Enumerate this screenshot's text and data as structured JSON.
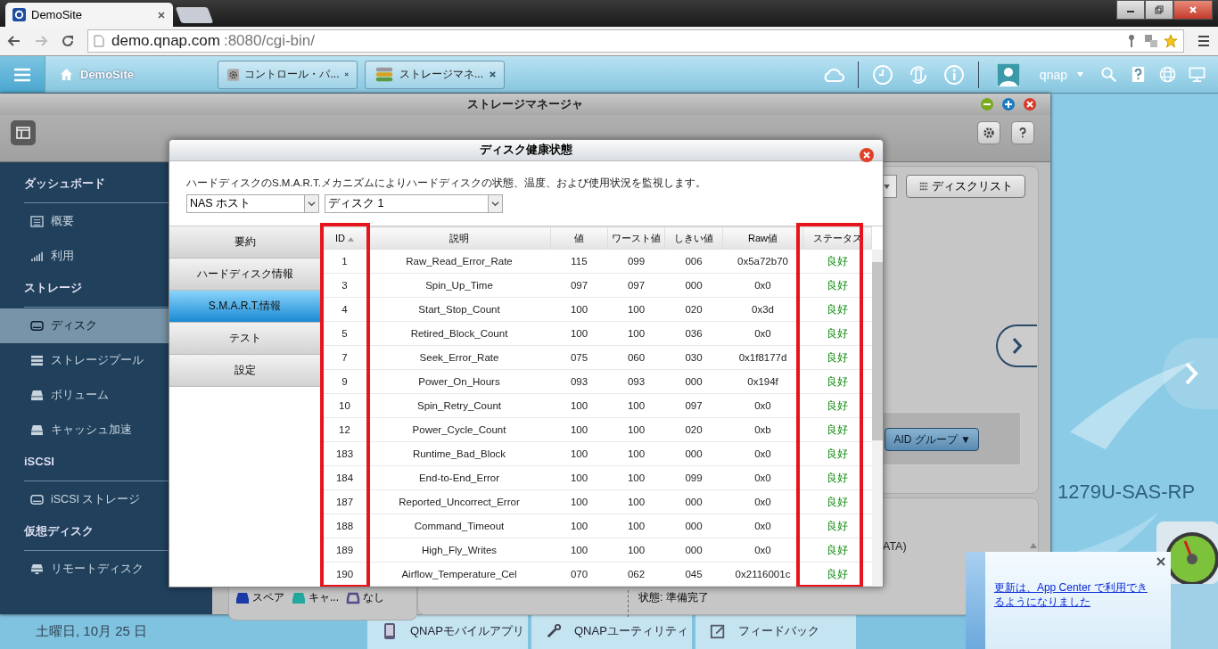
{
  "browser": {
    "tab_title": "DemoSite",
    "url_host": "demo.qnap.com",
    "url_rest": ":8080/cgi-bin/"
  },
  "topbar": {
    "home_label": "DemoSite",
    "app_tabs": [
      {
        "label": "コントロール・パ..."
      },
      {
        "label": "ストレージマネ..."
      }
    ],
    "user": "qnap"
  },
  "window": {
    "title": "ストレージマネージャ",
    "sidebar": [
      {
        "heading": "ダッシュボード",
        "items": [
          {
            "label": "概要",
            "selected": false
          },
          {
            "label": "利用",
            "selected": false
          }
        ]
      },
      {
        "heading": "ストレージ",
        "items": [
          {
            "label": "ディスク",
            "selected": true
          },
          {
            "label": "ストレージプール",
            "selected": false
          },
          {
            "label": "ボリューム",
            "selected": false
          },
          {
            "label": "キャッシュ加速",
            "selected": false
          }
        ]
      },
      {
        "heading": "iSCSI",
        "items": [
          {
            "label": "iSCSI ストレージ",
            "selected": false
          }
        ]
      },
      {
        "heading": "仮想ディスク",
        "items": [
          {
            "label": "リモートディスク",
            "selected": false
          }
        ]
      }
    ],
    "disk_list_button": "ディスクリスト",
    "raid_button": "AID グループ ▼",
    "info_fragment": "ATA)",
    "status_text": "状態: 準備完了",
    "legend": [
      {
        "label": "スペア",
        "color": "#1b3aa8",
        "kind": "filled"
      },
      {
        "label": "キャ...",
        "color": "#22a89c",
        "kind": "filled"
      },
      {
        "label": "なし",
        "color": "#5a4a8a",
        "kind": "outline"
      }
    ]
  },
  "dialog": {
    "title": "ディスク健康状態",
    "description": "ハードディスクのS.M.A.R.T.メカニズムによりハードディスクの状態、温度、および使用状況を監視します。",
    "host_select": "NAS ホスト",
    "disk_select": "ディスク 1",
    "menu": [
      {
        "label": "要約",
        "selected": false
      },
      {
        "label": "ハードディスク情報",
        "selected": false
      },
      {
        "label": "S.M.A.R.T.情報",
        "selected": true
      },
      {
        "label": "テスト",
        "selected": false
      },
      {
        "label": "設定",
        "selected": false
      }
    ],
    "table": {
      "columns": [
        {
          "label": "ID",
          "highlighted": true,
          "sorted": true
        },
        {
          "label": "説明",
          "highlighted": false,
          "sorted": false
        },
        {
          "label": "値",
          "highlighted": false,
          "sorted": false
        },
        {
          "label": "ワースト値",
          "highlighted": false,
          "sorted": false
        },
        {
          "label": "しきい値",
          "highlighted": false,
          "sorted": false
        },
        {
          "label": "Raw値",
          "highlighted": false,
          "sorted": false
        },
        {
          "label": "ステータス",
          "highlighted": true,
          "sorted": false
        }
      ],
      "rows": [
        [
          "1",
          "Raw_Read_Error_Rate",
          "115",
          "099",
          "006",
          "0x5a72b70",
          "良好"
        ],
        [
          "3",
          "Spin_Up_Time",
          "097",
          "097",
          "000",
          "0x0",
          "良好"
        ],
        [
          "4",
          "Start_Stop_Count",
          "100",
          "100",
          "020",
          "0x3d",
          "良好"
        ],
        [
          "5",
          "Retired_Block_Count",
          "100",
          "100",
          "036",
          "0x0",
          "良好"
        ],
        [
          "7",
          "Seek_Error_Rate",
          "075",
          "060",
          "030",
          "0x1f8177d",
          "良好"
        ],
        [
          "9",
          "Power_On_Hours",
          "093",
          "093",
          "000",
          "0x194f",
          "良好"
        ],
        [
          "10",
          "Spin_Retry_Count",
          "100",
          "100",
          "097",
          "0x0",
          "良好"
        ],
        [
          "12",
          "Power_Cycle_Count",
          "100",
          "100",
          "020",
          "0xb",
          "良好"
        ],
        [
          "183",
          "Runtime_Bad_Block",
          "100",
          "100",
          "000",
          "0x0",
          "良好"
        ],
        [
          "184",
          "End-to-End_Error",
          "100",
          "100",
          "099",
          "0x0",
          "良好"
        ],
        [
          "187",
          "Reported_Uncorrect_Error",
          "100",
          "100",
          "000",
          "0x0",
          "良好"
        ],
        [
          "188",
          "Command_Timeout",
          "100",
          "100",
          "000",
          "0x0",
          "良好"
        ],
        [
          "189",
          "High_Fly_Writes",
          "100",
          "100",
          "000",
          "0x0",
          "良好"
        ],
        [
          "190",
          "Airflow_Temperature_Cel",
          "070",
          "062",
          "045",
          "0x2116001c",
          "良好"
        ]
      ]
    }
  },
  "notification": {
    "text": "更新は、App Center で利用できるようになりました"
  },
  "taskbar": {
    "date": "土曜日, 10月 25 日",
    "items": [
      "QNAPモバイルアプリ",
      "QNAPユーティリティ",
      "フィードバック"
    ]
  },
  "desktop": {
    "device_name": "1279U-SAS-RP"
  }
}
